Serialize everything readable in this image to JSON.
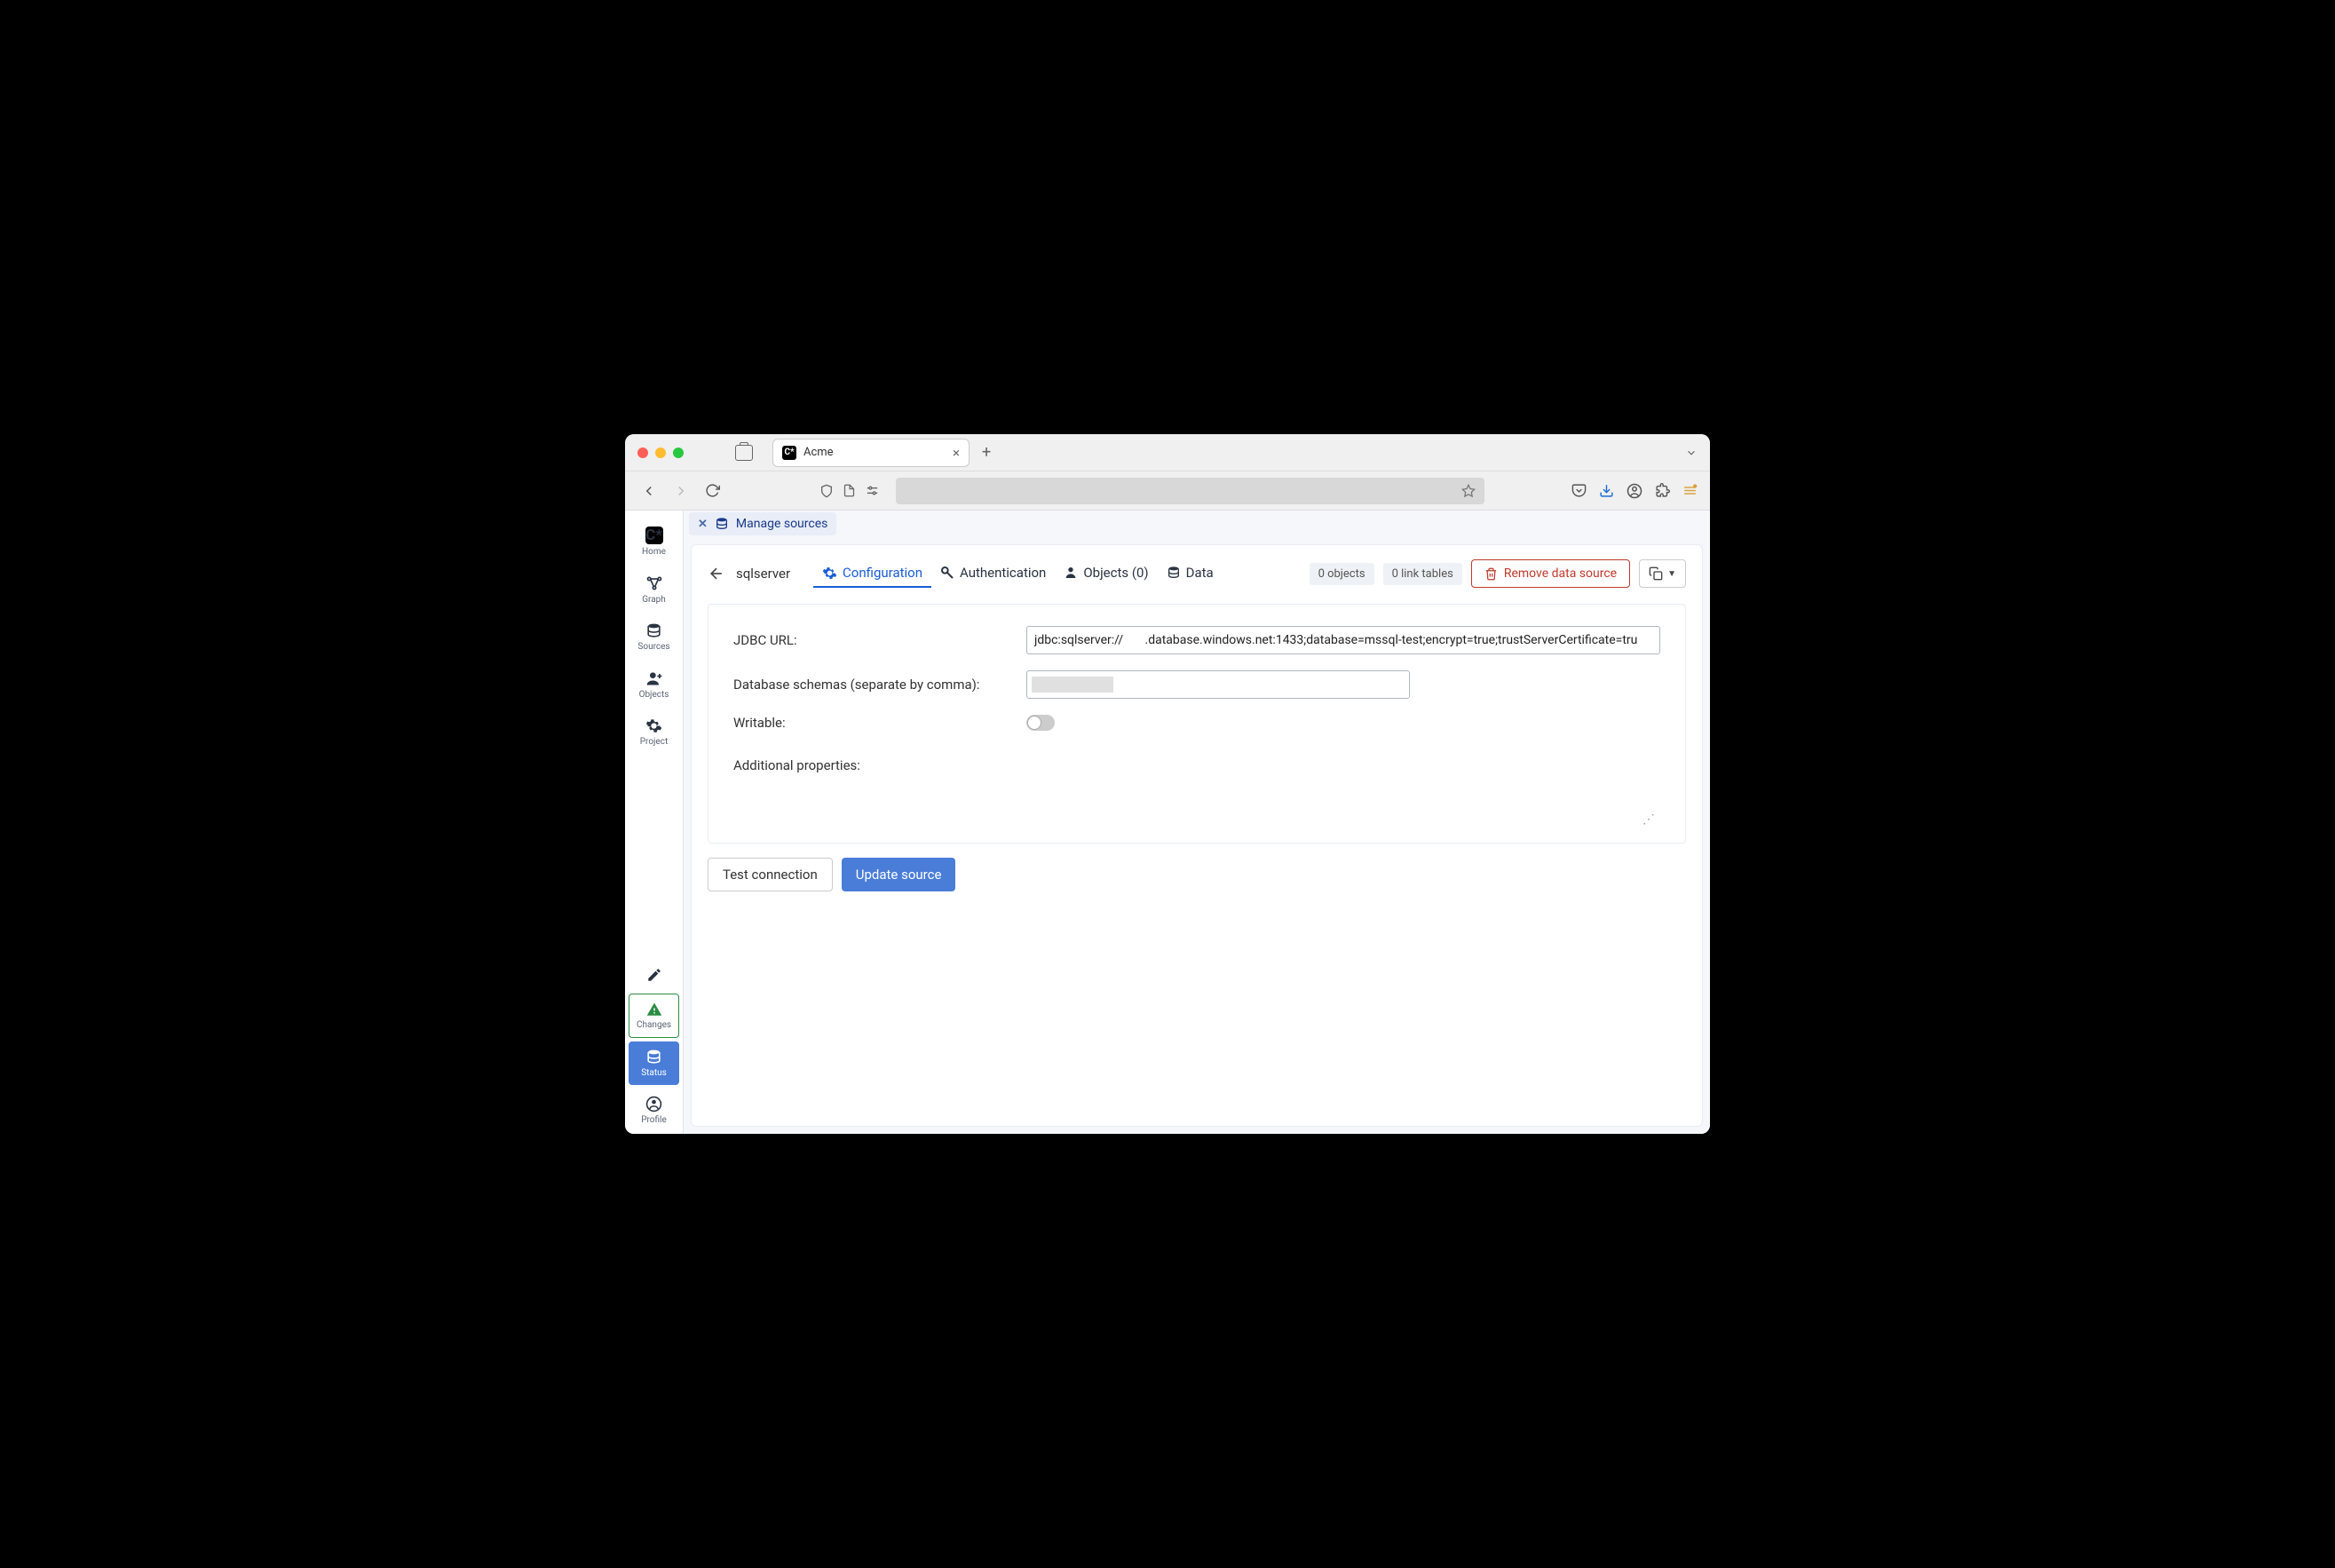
{
  "browser": {
    "tab_title": "Acme"
  },
  "sidebar": {
    "items": [
      {
        "label": "Home"
      },
      {
        "label": "Graph"
      },
      {
        "label": "Sources"
      },
      {
        "label": "Objects"
      },
      {
        "label": "Project"
      }
    ],
    "bottom": [
      {
        "label": "Changes"
      },
      {
        "label": "Status"
      },
      {
        "label": "Profile"
      }
    ]
  },
  "tabstrip": {
    "label": "Manage sources"
  },
  "panel": {
    "source_name": "sqlserver",
    "tabs": {
      "configuration": "Configuration",
      "authentication": "Authentication",
      "objects": "Objects (0)",
      "data": "Data"
    },
    "badges": {
      "objects": "0 objects",
      "link_tables": "0 link tables"
    },
    "remove_label": "Remove data source"
  },
  "form": {
    "jdbc_label": "JDBC URL:",
    "jdbc_value": "jdbc:sqlserver://       .database.windows.net:1433;database=mssql-test;encrypt=true;trustServerCertificate=tru",
    "schemas_label": "Database schemas (separate by comma):",
    "schemas_value": "",
    "writable_label": "Writable:",
    "writable": false,
    "additional_label": "Additional properties:",
    "test_label": "Test connection",
    "update_label": "Update source"
  }
}
